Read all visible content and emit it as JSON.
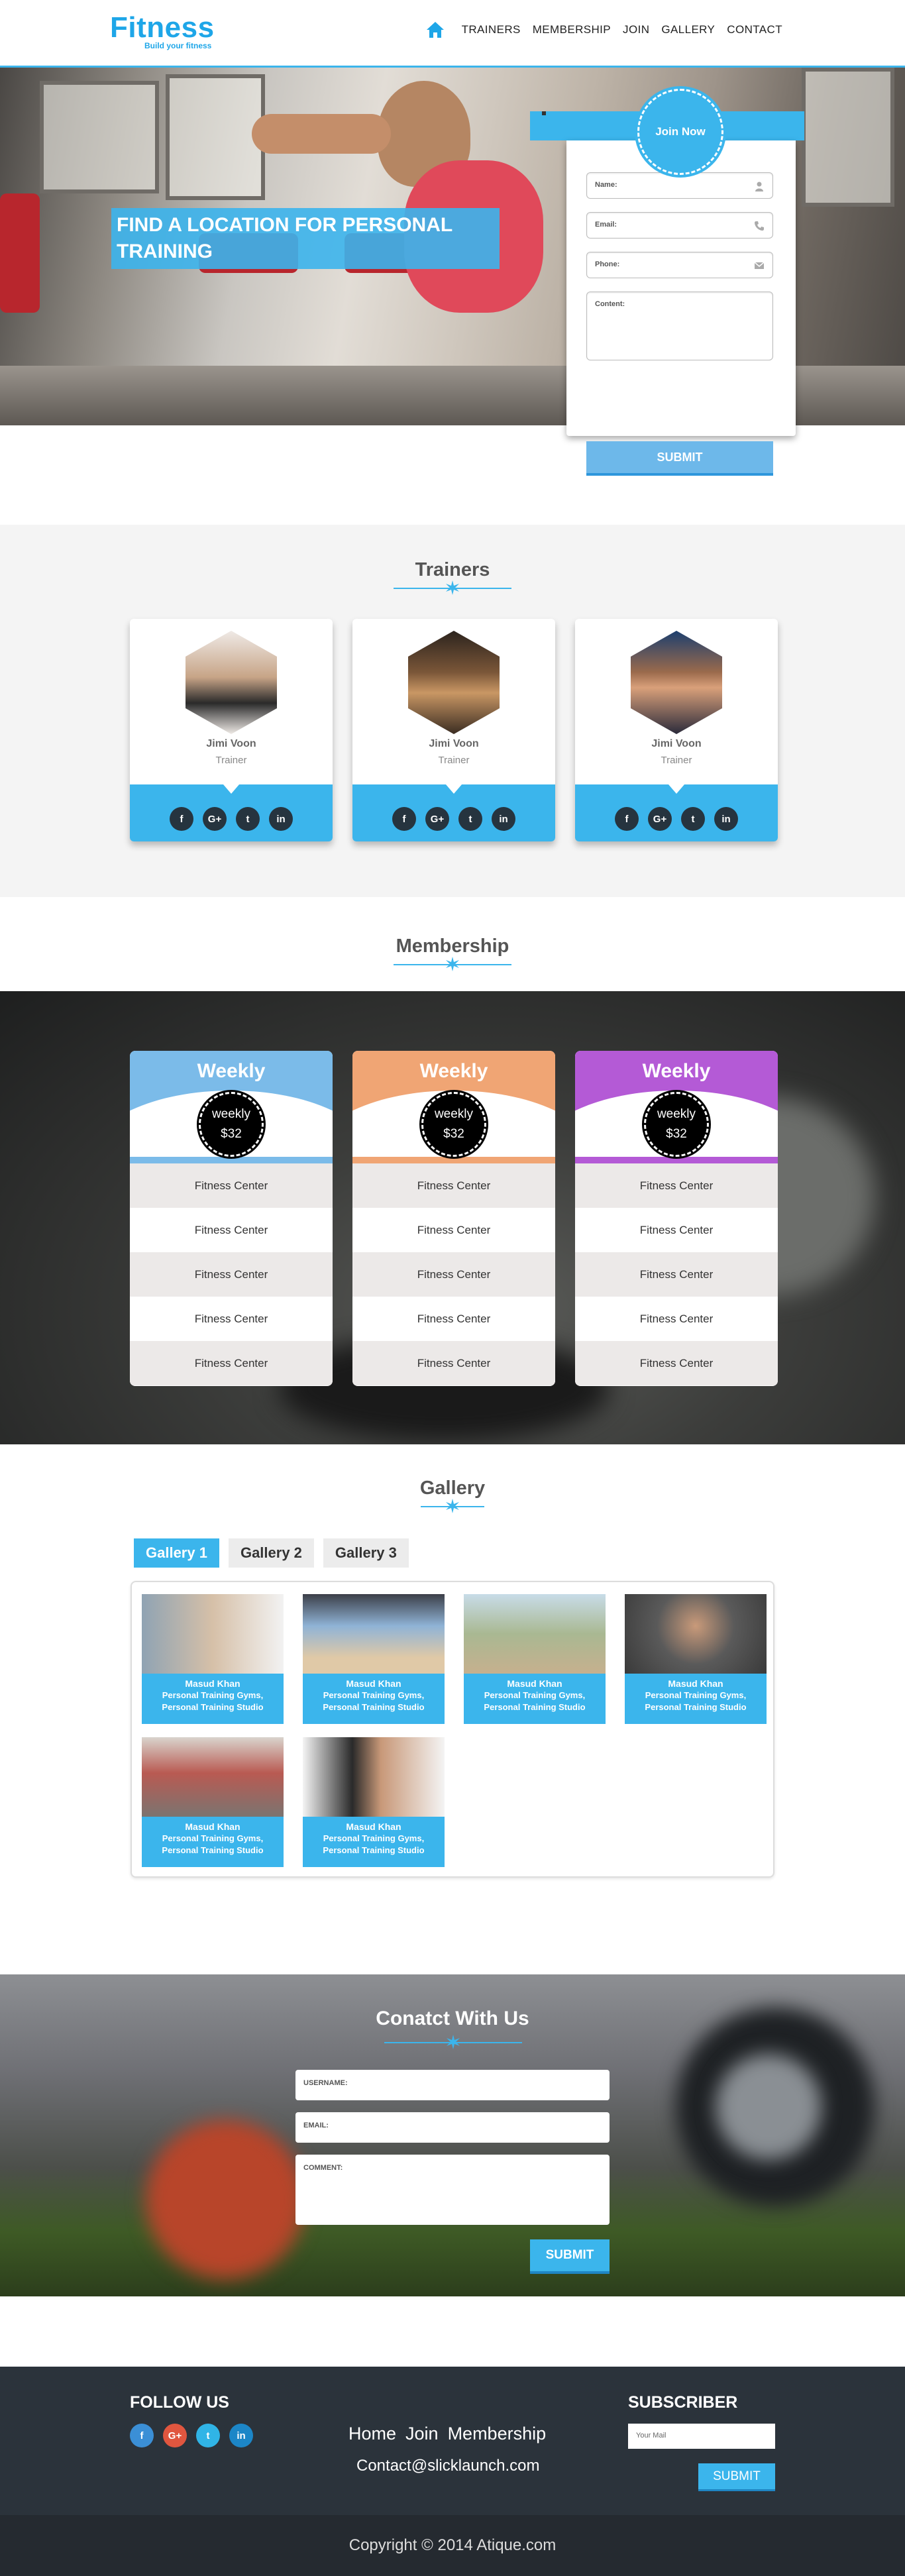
{
  "header": {
    "logo_title": "Fitness",
    "logo_subtitle": "Build your fitness",
    "nav": [
      "TRAINERS",
      "MEMBERSHIP",
      "JOIN",
      "GALLERY",
      "CONTACT"
    ],
    "accent_color": "#3bb5ec"
  },
  "hero": {
    "caption": "FIND A LOCATION FOR PERSONAL TRAINING",
    "join_badge": "Join Now",
    "fields": {
      "name": "Name:",
      "email": "Email:",
      "phone": "Phone:",
      "content": "Content:"
    },
    "submit": "SUBMIT"
  },
  "trainers": {
    "title": "Trainers",
    "items": [
      {
        "name": "Jimi Voon",
        "role": "Trainer"
      },
      {
        "name": "Jimi Voon",
        "role": "Trainer"
      },
      {
        "name": "Jimi Voon",
        "role": "Trainer"
      }
    ],
    "social": [
      "f",
      "G+",
      "t",
      "in"
    ]
  },
  "membership": {
    "title": "Membership",
    "plans": [
      {
        "title": "Weekly",
        "price_label": "weekly",
        "price": "$32",
        "color": "#7bbbe9",
        "rows": [
          "Fitness Center",
          "Fitness Center",
          "Fitness Center",
          "Fitness Center",
          "Fitness Center"
        ]
      },
      {
        "title": "Weekly",
        "price_label": "weekly",
        "price": "$32",
        "color": "#f0a574",
        "rows": [
          "Fitness Center",
          "Fitness Center",
          "Fitness Center",
          "Fitness Center",
          "Fitness Center"
        ]
      },
      {
        "title": "Weekly",
        "price_label": "weekly",
        "price": "$32",
        "color": "#b45ad6",
        "rows": [
          "Fitness Center",
          "Fitness Center",
          "Fitness Center",
          "Fitness Center",
          "Fitness Center"
        ]
      }
    ]
  },
  "gallery": {
    "title": "Gallery",
    "tabs": [
      "Gallery 1",
      "Gallery 2",
      "Gallery 3"
    ],
    "active_tab": "Gallery 1",
    "items": [
      {
        "name": "Masud Khan",
        "line1": "Personal Training Gyms,",
        "line2": "Personal Training Studio"
      },
      {
        "name": "Masud Khan",
        "line1": "Personal Training Gyms,",
        "line2": "Personal Training Studio"
      },
      {
        "name": "Masud Khan",
        "line1": "Personal Training Gyms,",
        "line2": "Personal Training Studio"
      },
      {
        "name": "Masud Khan",
        "line1": "Personal Training Gyms,",
        "line2": "Personal Training Studio"
      },
      {
        "name": "Masud Khan",
        "line1": "Personal Training Gyms,",
        "line2": "Personal Training Studio"
      },
      {
        "name": "Masud Khan",
        "line1": "Personal Training Gyms,",
        "line2": "Personal Training Studio"
      }
    ]
  },
  "contact": {
    "title": "Conatct With Us",
    "username": "USERNAME:",
    "email": "EMAIL:",
    "comment": "COMMENT:",
    "submit": "SUBMIT"
  },
  "footer": {
    "follow_title": "FOLLOW US",
    "follow_icons": [
      "f",
      "G+",
      "t",
      "in"
    ],
    "links": [
      "Home",
      "Join",
      "Membership"
    ],
    "email": "Contact@slicklaunch.com",
    "subscriber_title": "SUBSCRIBER",
    "subscriber_placeholder": "Your Mail",
    "subscriber_submit": "SUBMIT",
    "copyright": "Copyright © 2014 Atique.com"
  }
}
